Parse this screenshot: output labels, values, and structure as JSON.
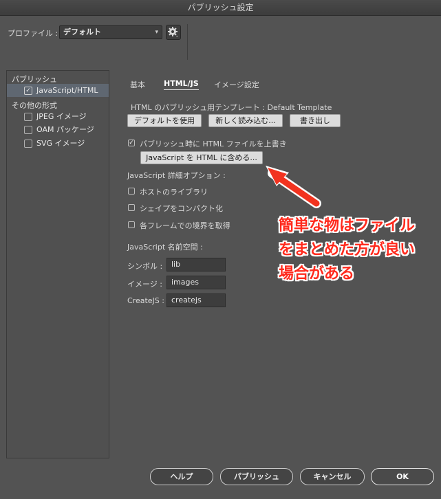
{
  "window": {
    "title": "パブリッシュ設定"
  },
  "profile": {
    "label": "プロファイル :",
    "selected": "デフォルト",
    "gear_icon": "gear-icon",
    "chevron_icon": "chevron-down-icon"
  },
  "sidebar": {
    "section_publish": "パブリッシュ",
    "publish_items": [
      {
        "label": "JavaScript/HTML",
        "checked": true,
        "selected": true
      }
    ],
    "section_other": "その他の形式",
    "other_items": [
      {
        "label": "JPEG イメージ",
        "checked": false
      },
      {
        "label": "OAM パッケージ",
        "checked": false
      },
      {
        "label": "SVG イメージ",
        "checked": false
      }
    ]
  },
  "tabs": [
    {
      "label": "基本",
      "active": false
    },
    {
      "label": "HTML/JS",
      "active": true
    },
    {
      "label": "イメージ設定",
      "active": false
    }
  ],
  "html_js": {
    "template_text": "HTML のパブリッシュ用テンプレート : Default Template",
    "use_default_button": "デフォルトを使用",
    "import_new_button": "新しく読み込む...",
    "export_button": "書き出し",
    "overwrite_label": "パブリッシュ時に HTML ファイルを上書き",
    "overwrite_checked": true,
    "include_js_button": "JavaScript を HTML に含める...",
    "advanced_heading": "JavaScript 詳細オプション :",
    "options": [
      {
        "label": "ホストのライブラリ",
        "checked": false
      },
      {
        "label": "シェイプをコンパクト化",
        "checked": false
      },
      {
        "label": "各フレームでの境界を取得",
        "checked": false
      }
    ],
    "namespace_heading": "JavaScript 名前空間 :",
    "namespaces": [
      {
        "label": "シンボル :",
        "value": "lib"
      },
      {
        "label": "イメージ :",
        "value": "images"
      },
      {
        "label": "CreateJS :",
        "value": "createjs"
      }
    ]
  },
  "annotation": {
    "lines": [
      "簡単な物はファイル",
      "をまとめた方が良い",
      "場合がある"
    ],
    "color": "#ff2a1d"
  },
  "footer": {
    "help": "ヘルプ",
    "publish": "パブリッシュ",
    "cancel": "キャンセル",
    "ok": "OK"
  }
}
